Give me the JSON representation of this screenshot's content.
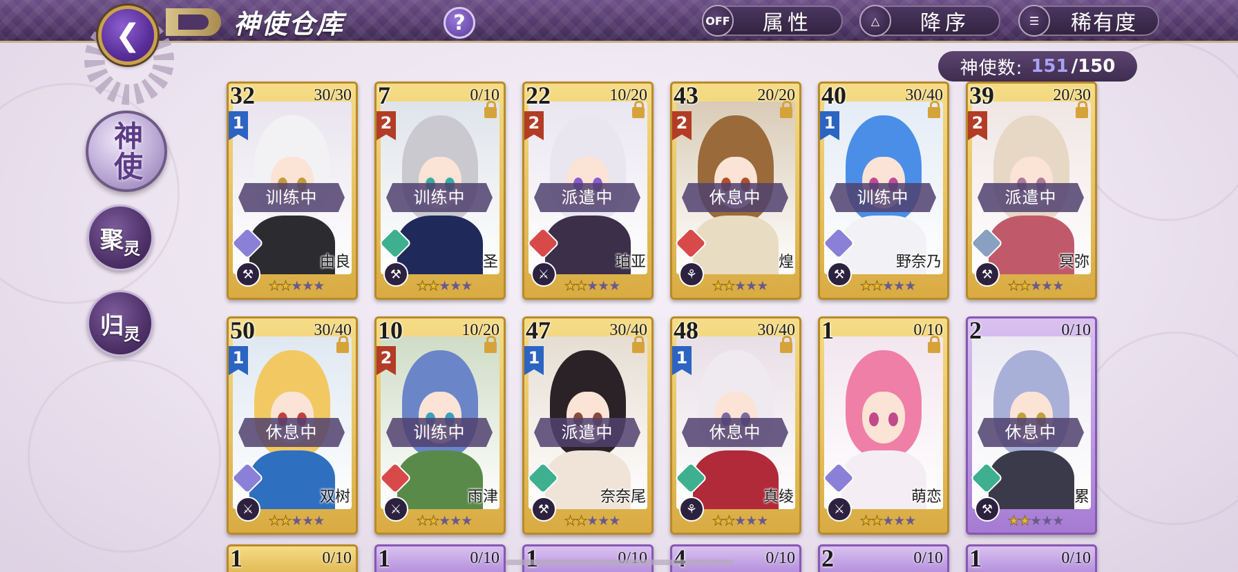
{
  "header": {
    "title": "神使仓库",
    "back_icon": "back-arrow-icon",
    "help_label": "?",
    "filter": {
      "toggle": "OFF",
      "label": "属性"
    },
    "sort_order": {
      "label": "降序"
    },
    "sort_by": {
      "label": "稀有度"
    }
  },
  "count": {
    "label": "神使数:",
    "current": "151",
    "max": "/150"
  },
  "nav": {
    "active": "神使",
    "item2": {
      "main": "聚",
      "sub": "灵"
    },
    "item3": {
      "main": "归",
      "sub": "灵"
    }
  },
  "cards": [
    {
      "level": "32",
      "exp": "30/30",
      "rank": "1",
      "status": "训练中",
      "name": "由良",
      "stars": 2,
      "element": "#8a80d8",
      "weapon": "claw",
      "hair": "#f2f2f4",
      "eye": "#c59a3a",
      "body": "#2b2b30",
      "bg": "#e9e4ee",
      "frame": "gold",
      "lock": false
    },
    {
      "level": "7",
      "exp": "0/10",
      "rank": "2",
      "status": "训练中",
      "name": "圣",
      "stars": 2,
      "element": "#3fb08f",
      "weapon": "claw",
      "hair": "#c9c9cf",
      "eye": "#3aa9a0",
      "body": "#1f2a5a",
      "bg": "#dfe4ea",
      "frame": "gold",
      "lock": true
    },
    {
      "level": "22",
      "exp": "10/20",
      "rank": "2",
      "status": "派遣中",
      "name": "珀亚",
      "stars": 2,
      "element": "#d84a4a",
      "weapon": "sword",
      "hair": "#e9e6ef",
      "eye": "#8a5ad0",
      "body": "#3b2f4a",
      "bg": "#eae6f0",
      "frame": "gold",
      "lock": true
    },
    {
      "level": "43",
      "exp": "20/20",
      "rank": "2",
      "status": "休息中",
      "name": "煌",
      "stars": 2,
      "element": "#d84a4a",
      "weapon": "horn",
      "hair": "#9a6a3a",
      "eye": "#b0502a",
      "body": "#e8dcc2",
      "bg": "#d9cbb6",
      "frame": "gold",
      "lock": true
    },
    {
      "level": "40",
      "exp": "30/40",
      "rank": "1",
      "status": "训练中",
      "name": "野奈乃",
      "stars": 2,
      "element": "#8a80d8",
      "weapon": "claw",
      "hair": "#4a8ee8",
      "eye": "#c04a9a",
      "body": "#f2f2f6",
      "bg": "#e4ecf6",
      "frame": "gold",
      "lock": true
    },
    {
      "level": "39",
      "exp": "20/30",
      "rank": "2",
      "status": "派遣中",
      "name": "冥弥",
      "stars": 2,
      "element": "#8aa0c0",
      "weapon": "claw",
      "hair": "#e7d8c6",
      "eye": "#b07a9a",
      "body": "#c05a6a",
      "bg": "#f0e6e4",
      "frame": "gold",
      "lock": true
    },
    {
      "level": "50",
      "exp": "30/40",
      "rank": "1",
      "status": "休息中",
      "name": "双树",
      "stars": 2,
      "element": "#8a80d8",
      "weapon": "sword",
      "hair": "#f2c862",
      "eye": "#c04040",
      "body": "#2f6fc0",
      "bg": "#dfe8f2",
      "frame": "gold",
      "lock": true
    },
    {
      "level": "10",
      "exp": "10/20",
      "rank": "2",
      "status": "训练中",
      "name": "雨津",
      "stars": 2,
      "element": "#d84a4a",
      "weapon": "sword",
      "hair": "#6a86c8",
      "eye": "#3aa0c0",
      "body": "#5a8a4a",
      "bg": "#cfdcc6",
      "frame": "gold",
      "lock": true
    },
    {
      "level": "47",
      "exp": "30/40",
      "rank": "1",
      "status": "派遣中",
      "name": "奈奈尾",
      "stars": 2,
      "element": "#3fb08f",
      "weapon": "claw",
      "hair": "#2a2226",
      "eye": "#8a4a3a",
      "body": "#f0e4d8",
      "bg": "#e6ddd2",
      "frame": "gold",
      "lock": true
    },
    {
      "level": "48",
      "exp": "30/40",
      "rank": "1",
      "status": "休息中",
      "name": "真绫",
      "stars": 2,
      "element": "#3fb08f",
      "weapon": "horn",
      "hair": "#efeaf0",
      "eye": "#7a6aa0",
      "body": "#b02a3a",
      "bg": "#e8dfe6",
      "frame": "gold",
      "lock": true
    },
    {
      "level": "1",
      "exp": "0/10",
      "rank": "",
      "status": "",
      "name": "萌恋",
      "stars": 2,
      "element": "#8a80d8",
      "weapon": "sword",
      "hair": "#ef7fa6",
      "eye": "#c04a8a",
      "body": "#f4eef4",
      "bg": "#f3e6ee",
      "frame": "gold",
      "lock": true
    },
    {
      "level": "2",
      "exp": "0/10",
      "rank": "",
      "status": "休息中",
      "name": "累",
      "stars": 2,
      "element": "#3fb08f",
      "weapon": "claw",
      "hair": "#a8b0d8",
      "eye": "#c0a040",
      "body": "#3a3a4a",
      "bg": "#eceaf2",
      "frame": "purple",
      "lock": false
    }
  ],
  "bottom_row": [
    {
      "level": "1",
      "exp": "0/10",
      "frame": "gold"
    },
    {
      "level": "1",
      "exp": "0/10",
      "frame": "purple"
    },
    {
      "level": "1",
      "exp": "0/10",
      "frame": "purple"
    },
    {
      "level": "4",
      "exp": "0/10",
      "frame": "purple"
    },
    {
      "level": "2",
      "exp": "0/10",
      "frame": "purple"
    },
    {
      "level": "1",
      "exp": "0/10",
      "frame": "purple"
    }
  ],
  "star_max": 5,
  "colors": {
    "accent": "#4e3566",
    "count_highlight": "#a9a3f5",
    "gold_frame": "#d9ab42",
    "purple_frame": "#a57bd3"
  }
}
